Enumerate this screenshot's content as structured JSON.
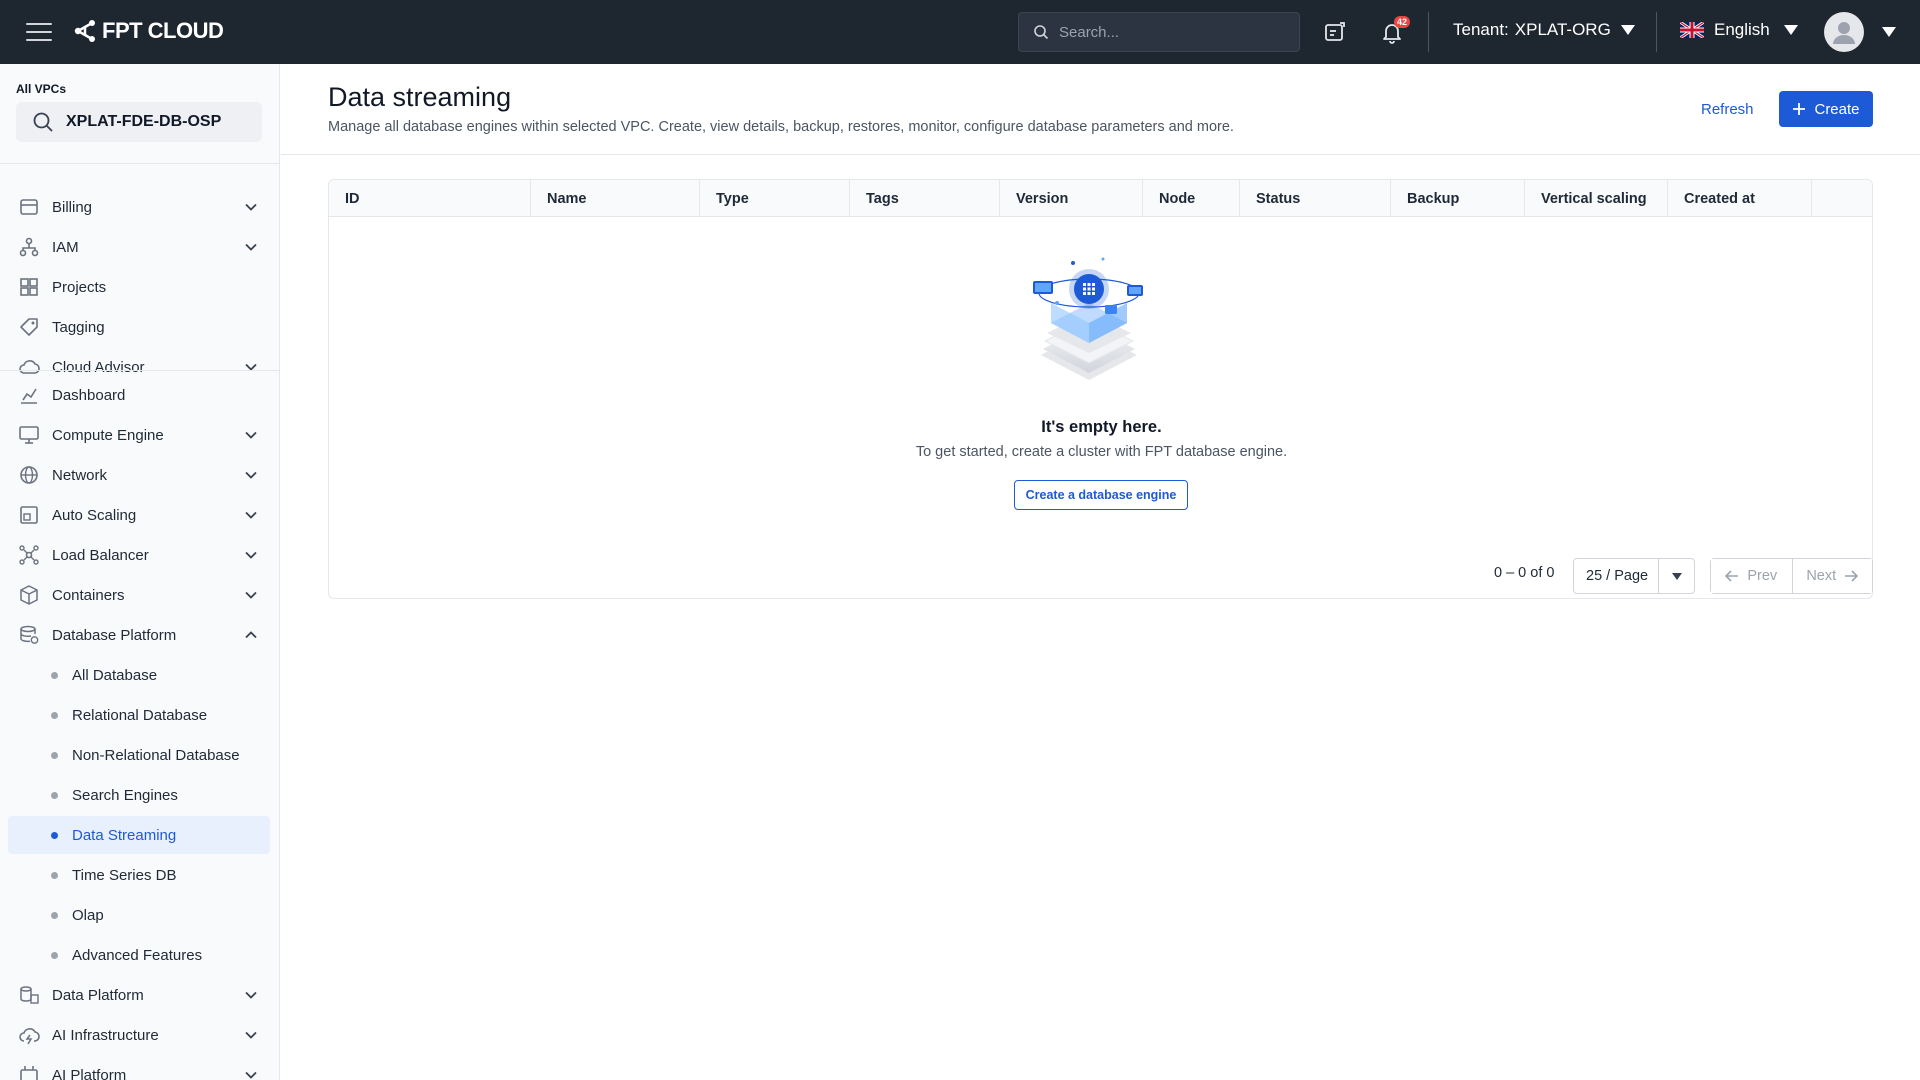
{
  "topbar": {
    "brand": "FPT CLOUD",
    "search_placeholder": "Search...",
    "notification_count": "42",
    "tenant_label": "Tenant:",
    "tenant_value": "XPLAT-ORG",
    "language": "English"
  },
  "sidebar": {
    "vpc_label": "All VPCs",
    "vpc_value": "XPLAT-FDE-DB-OSP",
    "group1": [
      {
        "label": "Billing",
        "icon": "billing-icon",
        "expandable": true
      },
      {
        "label": "IAM",
        "icon": "iam-icon",
        "expandable": true
      },
      {
        "label": "Projects",
        "icon": "projects-icon",
        "expandable": false
      },
      {
        "label": "Tagging",
        "icon": "tag-icon",
        "expandable": false
      },
      {
        "label": "Cloud Advisor",
        "icon": "cloud-advisor-icon",
        "expandable": true
      }
    ],
    "group2": [
      {
        "label": "Dashboard",
        "icon": "dashboard-icon",
        "expandable": false
      },
      {
        "label": "Compute Engine",
        "icon": "monitor-icon",
        "expandable": true
      },
      {
        "label": "Network",
        "icon": "globe-icon",
        "expandable": true
      },
      {
        "label": "Auto Scaling",
        "icon": "auto-scaling-icon",
        "expandable": true
      },
      {
        "label": "Load Balancer",
        "icon": "load-balancer-icon",
        "expandable": true
      },
      {
        "label": "Containers",
        "icon": "box-icon",
        "expandable": true
      },
      {
        "label": "Database Platform",
        "icon": "database-icon",
        "expandable": true,
        "expanded": true
      }
    ],
    "db_subitems": [
      {
        "label": "All Database"
      },
      {
        "label": "Relational Database"
      },
      {
        "label": "Non-Relational Database"
      },
      {
        "label": "Search Engines"
      },
      {
        "label": "Data Streaming",
        "active": true
      },
      {
        "label": "Time Series DB"
      },
      {
        "label": "Olap"
      },
      {
        "label": "Advanced Features"
      }
    ],
    "group3": [
      {
        "label": "Data Platform",
        "icon": "data-platform-icon",
        "expandable": true
      },
      {
        "label": "AI Infrastructure",
        "icon": "ai-infra-icon",
        "expandable": true
      },
      {
        "label": "AI Platform",
        "icon": "ai-platform-icon",
        "expandable": true
      }
    ]
  },
  "main": {
    "title": "Data streaming",
    "subtitle": "Manage all database engines within selected VPC. Create, view details, backup, restores, monitor, configure database parameters and more.",
    "refresh_label": "Refresh",
    "create_label": "Create",
    "columns": [
      "ID",
      "Name",
      "Type",
      "Tags",
      "Version",
      "Node",
      "Status",
      "Backup",
      "Vertical scaling",
      "Created at",
      ""
    ],
    "empty_title": "It's empty here.",
    "empty_subtitle": "To get started, create a cluster with FPT database engine.",
    "empty_button": "Create a database engine",
    "pager_count": "0 – 0 of 0",
    "page_size": "25 / Page",
    "prev_label": "Prev",
    "next_label": "Next"
  },
  "colors": {
    "topbar_bg": "#1e2630",
    "accent": "#1d5ad8",
    "active_bg": "#e8f0fe"
  }
}
